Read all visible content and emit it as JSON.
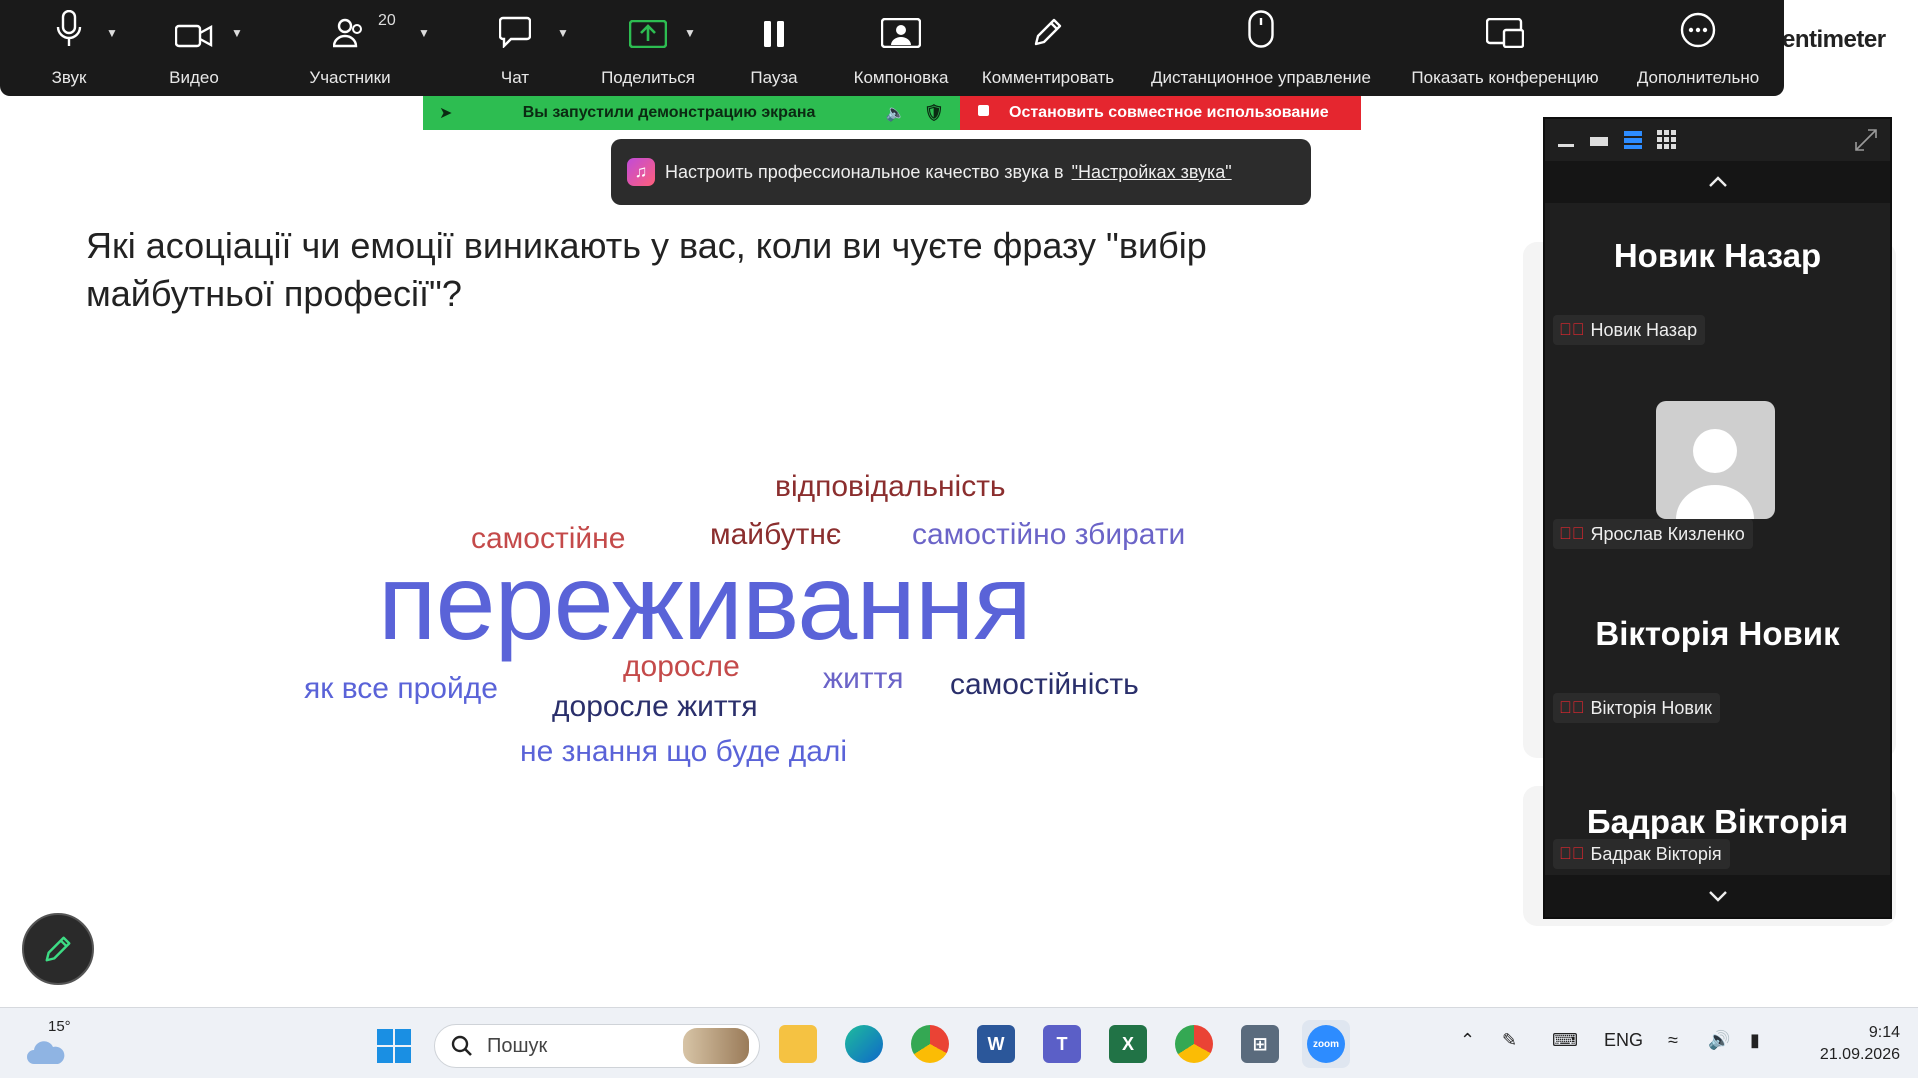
{
  "toolbar": {
    "items": [
      {
        "label": "Звук"
      },
      {
        "label": "Видео"
      },
      {
        "label": "Участники",
        "badge": "20"
      },
      {
        "label": "Чат"
      },
      {
        "label": "Поделиться"
      },
      {
        "label": "Пауза"
      },
      {
        "label": "Компоновка"
      },
      {
        "label": "Комментировать"
      },
      {
        "label": "Дистанционное управление"
      },
      {
        "label": "Показать конференцию"
      },
      {
        "label": "Дополнительно"
      }
    ],
    "brand_fragment": "entimeter"
  },
  "share_bar": {
    "status": "Вы запустили демонстрацию экрана",
    "stop": "Остановить совместное использование",
    "accent_green": "#2dbd51",
    "accent_red": "#e5262f"
  },
  "tooltip": {
    "text": "Настроить профессиональное качество звука в",
    "link": "\"Настройках звука\""
  },
  "slide": {
    "question": "Які асоціації чи емоції виникають у вас, коли ви чуєте фразу \"вибір майбутньої професії\"?",
    "words": [
      {
        "text": "відповідальність",
        "color": "#8b2e2e"
      },
      {
        "text": "самостійне",
        "color": "#c44a4a"
      },
      {
        "text": "майбутнє",
        "color": "#8b2e2e"
      },
      {
        "text": "самостійно збирати",
        "color": "#6b64c8"
      },
      {
        "text": "переживання",
        "color": "#5a63d8"
      },
      {
        "text": "доросле",
        "color": "#c44a4a"
      },
      {
        "text": "життя",
        "color": "#6b64c8"
      },
      {
        "text": "як все пройде",
        "color": "#5a63d8"
      },
      {
        "text": "доросле життя",
        "color": "#2a2f6b"
      },
      {
        "text": "самостійність",
        "color": "#2a2f6b"
      },
      {
        "text": "не знання що буде далі",
        "color": "#5a63d8"
      }
    ]
  },
  "gallery": {
    "participants": [
      {
        "big_name": "Новик Назар",
        "tag": "Новик Назар"
      },
      {
        "big_name": "",
        "tag": "Ярослав Кизленко"
      },
      {
        "big_name": "Вікторія Новик",
        "tag": "Вікторія Новик"
      },
      {
        "big_name": "Бадрак Вікторія",
        "tag": "Бадрак Вікторія"
      }
    ]
  },
  "taskbar": {
    "weather_temp": "15°",
    "search_placeholder": "Пошук",
    "lang": "ENG",
    "time": "9:14",
    "date": "21.09.2026",
    "apps": [
      "file-explorer",
      "edge",
      "chrome-profile",
      "word",
      "teams",
      "excel",
      "chrome",
      "calculator",
      "zoom"
    ]
  }
}
